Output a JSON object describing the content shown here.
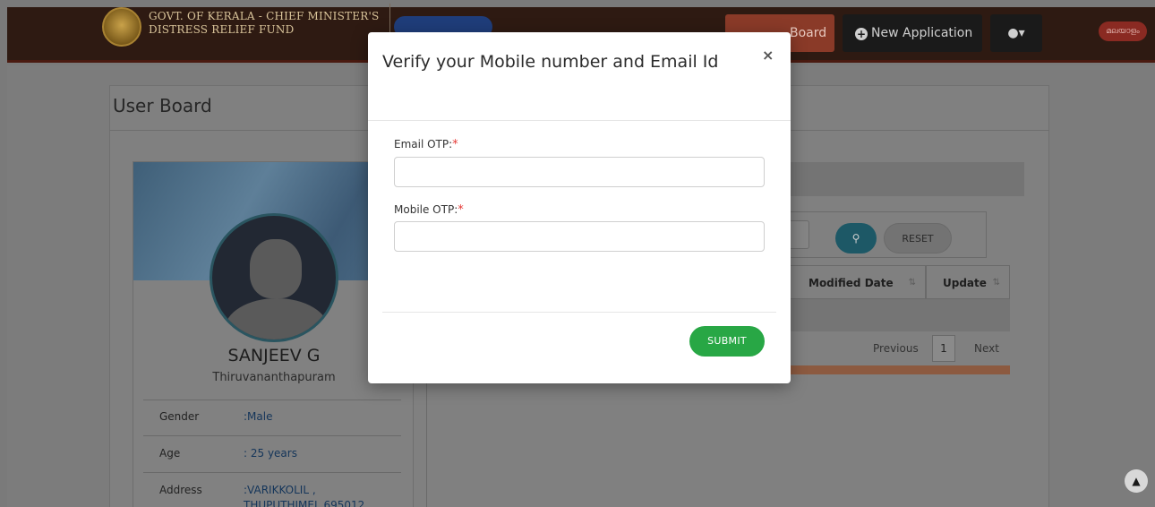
{
  "header": {
    "brand_line1": "GOVT. OF KERALA - CHIEF MINISTER'S",
    "brand_line2": "DISTRESS RELIEF FUND",
    "nav_board": "Board",
    "nav_new_application": "New Application",
    "nav_user_caret": "▾",
    "language_button": "മലയാളം"
  },
  "user_board": {
    "title": "User Board",
    "profile": {
      "name": "SANJEEV G",
      "district": "Thiruvananthapuram",
      "rows": [
        {
          "label": "Gender",
          "value": ":Male"
        },
        {
          "label": "Age",
          "value": ": 25 years"
        },
        {
          "label": "Address",
          "value": ":VARIKKOLIL ,"
        },
        {
          "label": "",
          "value": "THUPUTHIMEL 695012"
        }
      ]
    },
    "table": {
      "search_button_icon": "search-icon",
      "reset_label": "RESET",
      "columns": [
        "Modified Date",
        "Update"
      ],
      "pagination": {
        "previous": "Previous",
        "current": "1",
        "next": "Next"
      }
    }
  },
  "modal": {
    "title": "Verify your Mobile number and Email Id",
    "close_symbol": "×",
    "email_otp_label": "Email OTP:",
    "mobile_otp_label": "Mobile OTP:",
    "required_marker": "*",
    "email_otp_value": "",
    "mobile_otp_value": "",
    "submit_label": "SUBMIT"
  },
  "colors": {
    "submit_green": "#28a745",
    "required_red": "#e53935",
    "navbar_dark": "#2e1a12"
  }
}
